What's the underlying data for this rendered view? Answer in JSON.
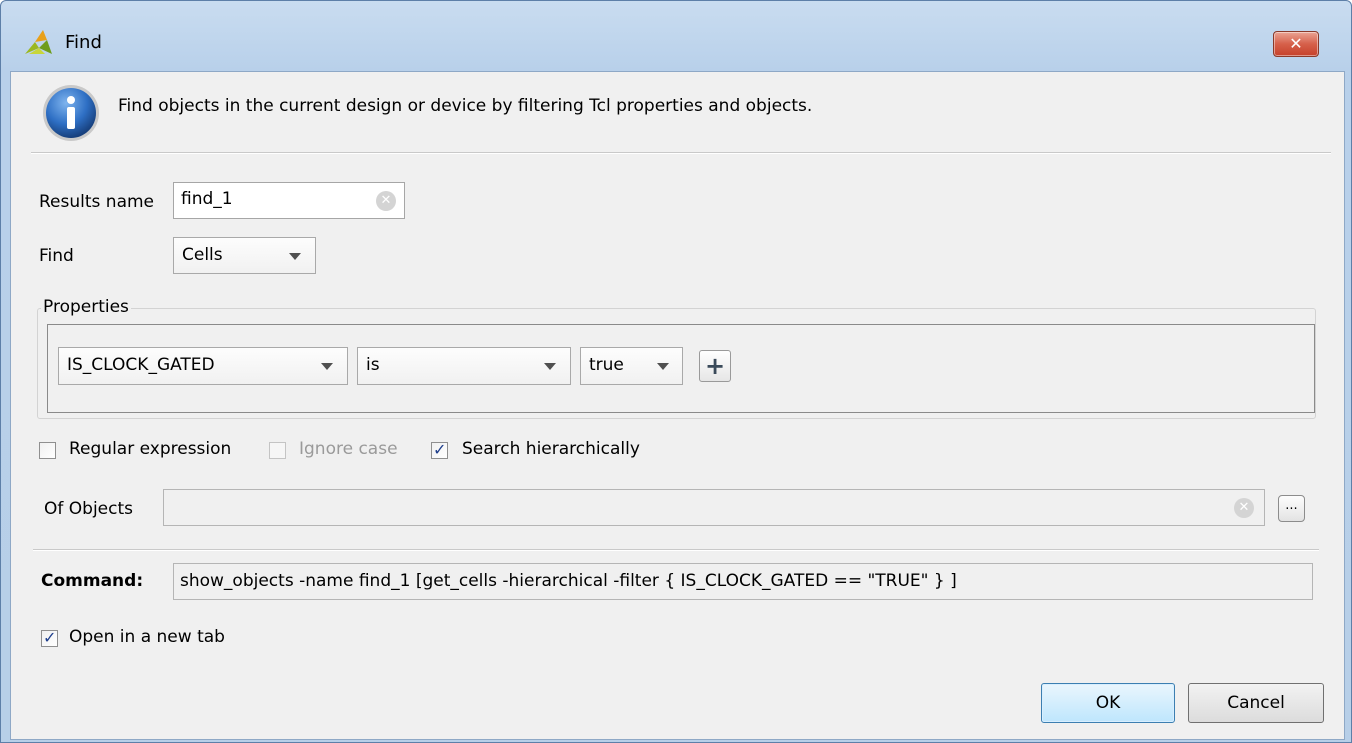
{
  "window": {
    "title": "Find",
    "close_glyph": "✕"
  },
  "info": {
    "text": "Find objects in the current design or device by filtering Tcl properties and objects."
  },
  "results_name": {
    "label": "Results name",
    "value": "find_1"
  },
  "find": {
    "label": "Find",
    "selected": "Cells"
  },
  "properties": {
    "title": "Properties",
    "property": "IS_CLOCK_GATED",
    "operator": "is",
    "value": "true",
    "add_glyph": "+"
  },
  "options": {
    "regular_expression": {
      "label": "Regular expression",
      "checked": false
    },
    "ignore_case": {
      "label": "Ignore case",
      "checked": false,
      "enabled": false
    },
    "search_hierarchically": {
      "label": "Search hierarchically",
      "checked": true
    }
  },
  "of_objects": {
    "label": "Of Objects",
    "value": "",
    "browse_label": "..."
  },
  "command": {
    "label": "Command:",
    "value": "show_objects -name find_1 [get_cells -hierarchical -filter { IS_CLOCK_GATED == \"TRUE\" } ]"
  },
  "open_new_tab": {
    "label": "Open in a new tab",
    "checked": true
  },
  "buttons": {
    "ok": "OK",
    "cancel": "Cancel"
  },
  "colors": {
    "title_bar": "#b9d1ea",
    "ok_border": "#3c7fb1",
    "close_red": "#c6402a"
  }
}
